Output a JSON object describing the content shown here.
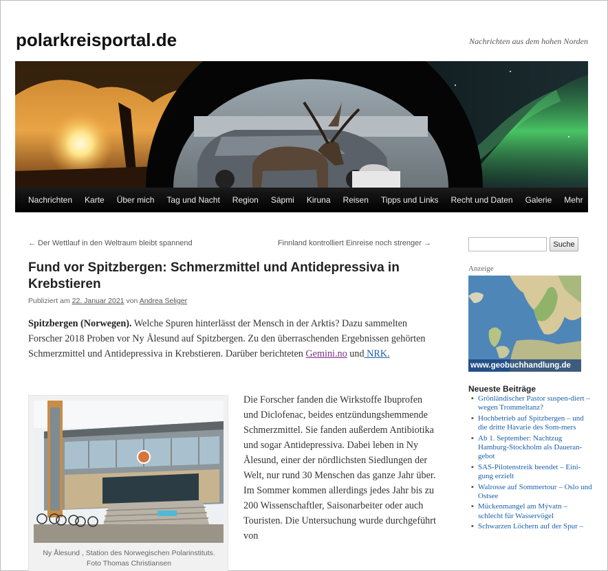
{
  "site": {
    "title": "polarkreisportal.de",
    "description": "Nachrichten aus dem hohen Norden"
  },
  "nav": {
    "items": [
      "Nachrichten",
      "Karte",
      "Über mich",
      "Tag und Nacht",
      "Region",
      "Sápmi",
      "Kiruna",
      "Reisen",
      "Tipps und Links",
      "Recht und Daten",
      "Galerie",
      "Mehr"
    ]
  },
  "post_nav": {
    "previous": "← Der Wettlauf in den Weltraum bleibt spannend",
    "next": "Finnland kontrolliert Einreise noch strenger →"
  },
  "article": {
    "title": "Fund vor Spitzbergen: Schmerzmittel und Antidepressiva in Krebstieren",
    "meta_prefix": "Publiziert am ",
    "date": "22. Januar 2021",
    "meta_by": " von ",
    "author": "Andrea Seliger",
    "lead_bold": "Spitzbergen (Norwegen).",
    "lead_text": " Welche Spuren hinterlässt der Mensch in der Arktis? Dazu sammelten Forscher 2018 Proben vor Ny Ålesund auf Spitzbergen. Zu den überraschenden Ergebnissen gehörten Schmerzmittel und Antidepressiva in Krebstieren. Darüber berichteten ",
    "link1": "Gemini.no",
    "link_and": " und",
    "link2": " NRK.",
    "body": "Die Forscher fanden die Wirkstoffe Ibuprofen und Diclofenac, beides entzündungshemmende Schmerzmittel. Sie fanden außerdem Antibiotika und sogar Antidepressiva. Dabei leben in Ny Ålesund, einer der nördlichsten Siedlungen der Welt, nur rund 30 Menschen das ganze Jahr über. Im Sommer kommen allerdings jedes Jahr bis zu 200 Wissenschaftler, Saisonarbeiter oder auch Touristen. Die Untersuchung wurde durchgeführt von",
    "figure_caption_1": "Ny Ålesund , Station des Norwegischen Polarinstituts.",
    "figure_caption_2": "Foto Thomas Christiansen"
  },
  "sidebar": {
    "search_placeholder": "",
    "search_button": "Suche",
    "ad_label": "Anzeige",
    "ad_url": "www.geobuchhandlung.de",
    "recent_title": "Neueste Beiträge",
    "recent_posts": [
      "Grönländischer Pastor suspen-diert – wegen Trommeltanz?",
      "Hochbetrieb auf Spitzbergen – und die dritte Havarie des Som-mers",
      "Ab 1. September: Nachtzug Hamburg-Stockholm als Daueran-gebot",
      "SAS-Pilotenstreik beendet – Eini-gung erzielt",
      "Walrosse auf Sommertour – Oslo und Ostsee",
      "Mückenmangel am Mývatn – schlecht für Wasservögel",
      "Schwarzen Löchern auf der Spur –"
    ]
  }
}
